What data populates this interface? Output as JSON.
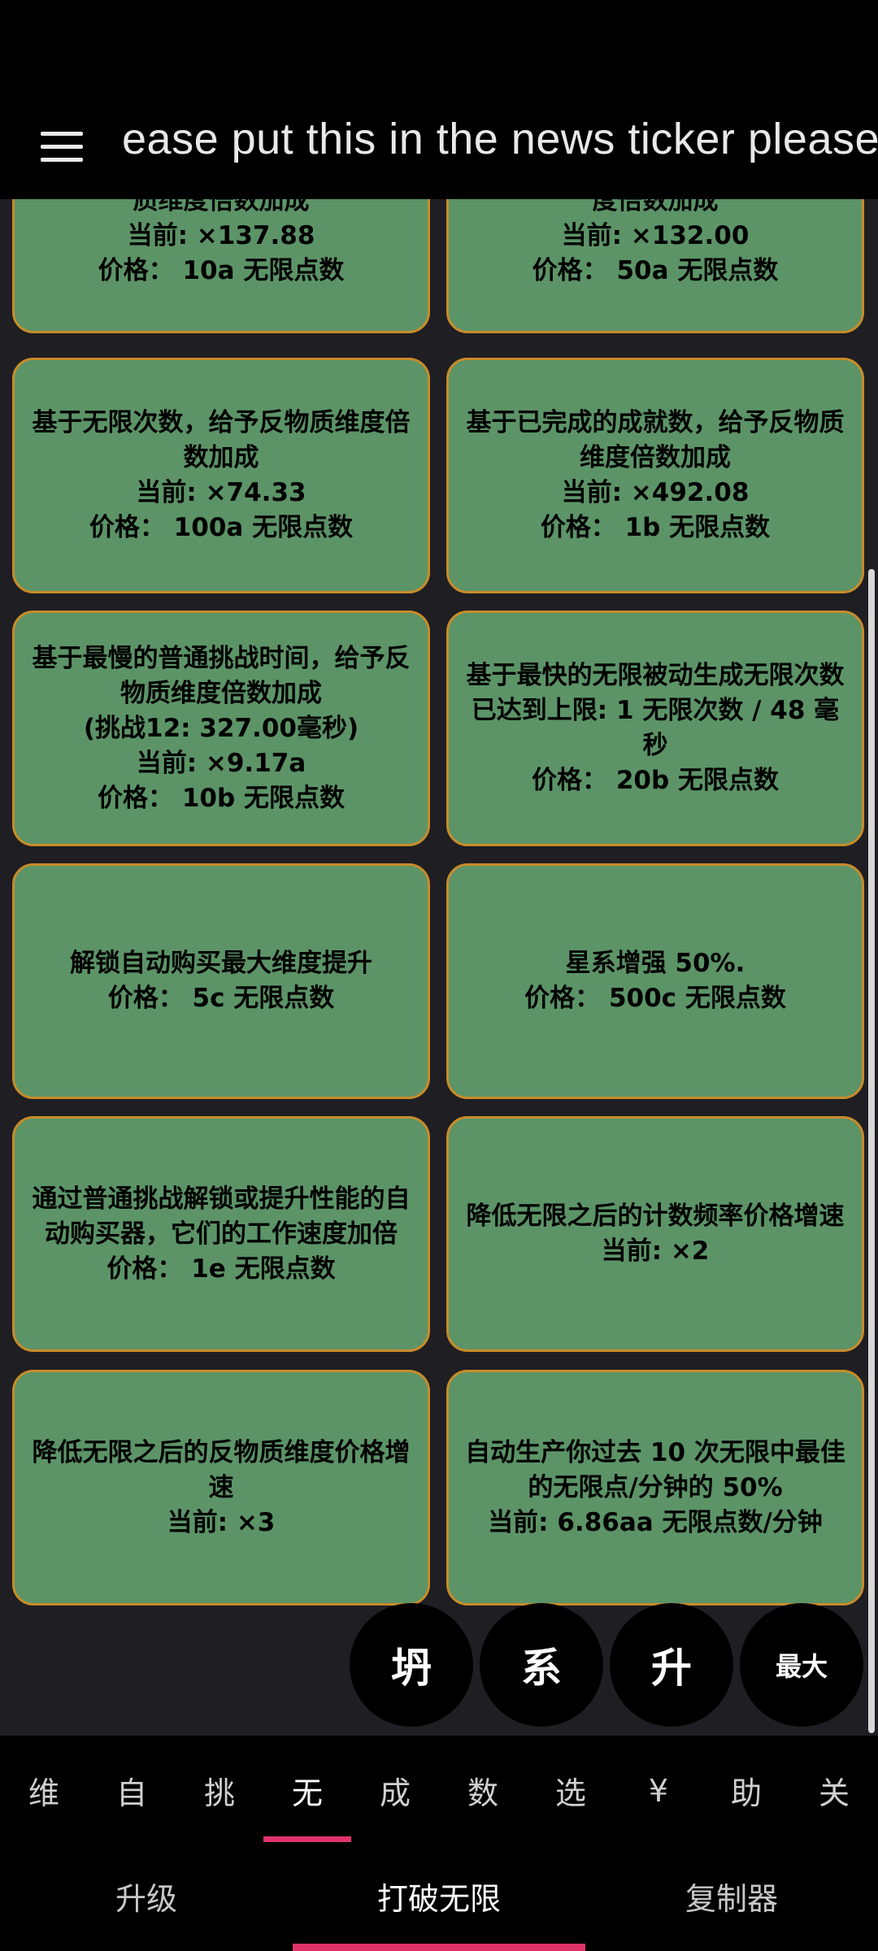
{
  "news_ticker": "ease put this in the news ticker please",
  "upgrades": [
    {
      "desc": "质维度倍数加成",
      "lines": [
        "当前: ×137.88",
        "价格： 10a 无限点数"
      ]
    },
    {
      "desc": "度倍数加成",
      "lines": [
        "当前: ×132.00",
        "价格： 50a 无限点数"
      ]
    },
    {
      "desc": "基于无限次数，给予反物质维度倍数加成",
      "lines": [
        "当前: ×74.33",
        "价格： 100a 无限点数"
      ]
    },
    {
      "desc": "基于已完成的成就数，给予反物质维度倍数加成",
      "lines": [
        "当前: ×492.08",
        "价格： 1b 无限点数"
      ]
    },
    {
      "desc": "基于最慢的普通挑战时间，给予反物质维度倍数加成",
      "lines": [
        "(挑战12: 327.00毫秒)",
        "当前: ×9.17a",
        "价格： 10b 无限点数"
      ]
    },
    {
      "desc": "基于最快的无限被动生成无限次数",
      "lines": [
        "已达到上限: 1 无限次数 / 48 毫秒",
        "价格： 20b 无限点数"
      ]
    },
    {
      "desc": "解锁自动购买最大维度提升",
      "lines": [
        "价格： 5c 无限点数"
      ]
    },
    {
      "desc": "星系增强 50%.",
      "lines": [
        "价格： 500c 无限点数"
      ]
    },
    {
      "desc": "通过普通挑战解锁或提升性能的自动购买器，它们的工作速度加倍",
      "lines": [
        "价格： 1e 无限点数"
      ]
    },
    {
      "desc": "降低无限之后的计数频率价格增速",
      "lines": [
        "当前: ×2"
      ]
    },
    {
      "desc": "降低无限之后的反物质维度价格增速",
      "lines": [
        "当前: ×3"
      ]
    },
    {
      "desc": "自动生产你过去 10 次无限中最佳的无限点/分钟的 50%",
      "lines": [
        "当前: 6.86aa 无限点数/分钟"
      ]
    }
  ],
  "fabs": [
    "坍",
    "系",
    "升",
    "最大"
  ],
  "tabs": [
    "维",
    "自",
    "挑",
    "无",
    "成",
    "数",
    "选",
    "¥",
    "助",
    "关"
  ],
  "active_tab": "无",
  "bottom_nav": [
    "升级",
    "打破无限",
    "复制器"
  ],
  "active_bottom_nav": "打破无限",
  "colors": {
    "card_bg": "#5c9467",
    "card_border": "#c88c2a",
    "accent": "#e0336b"
  }
}
